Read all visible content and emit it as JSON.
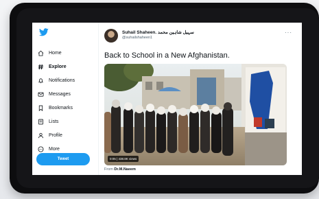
{
  "nav": {
    "items": [
      {
        "label": "Home",
        "icon": "home-icon"
      },
      {
        "label": "Explore",
        "icon": "hashtag-icon",
        "active": true
      },
      {
        "label": "Notifications",
        "icon": "bell-icon"
      },
      {
        "label": "Messages",
        "icon": "envelope-icon"
      },
      {
        "label": "Bookmarks",
        "icon": "bookmark-icon"
      },
      {
        "label": "Lists",
        "icon": "list-icon"
      },
      {
        "label": "Profile",
        "icon": "person-icon"
      },
      {
        "label": "More",
        "icon": "more-circle-icon"
      }
    ],
    "tweet_button": "Tweet"
  },
  "tweet": {
    "display_name": "Suhail Shaheen.",
    "display_name_script": "سہیل شاہین محمد",
    "handle": "@suhailshaheen1",
    "more": "···",
    "text": "Back to School in a New Afghanistan.",
    "video": {
      "timestamp": "0:05",
      "views": "438.8K views"
    },
    "from_prefix": "From",
    "from_name": "Dr.M.Naeem"
  },
  "colors": {
    "accent": "#1d9bf0",
    "text": "#0f1419",
    "secondary": "#536471"
  }
}
